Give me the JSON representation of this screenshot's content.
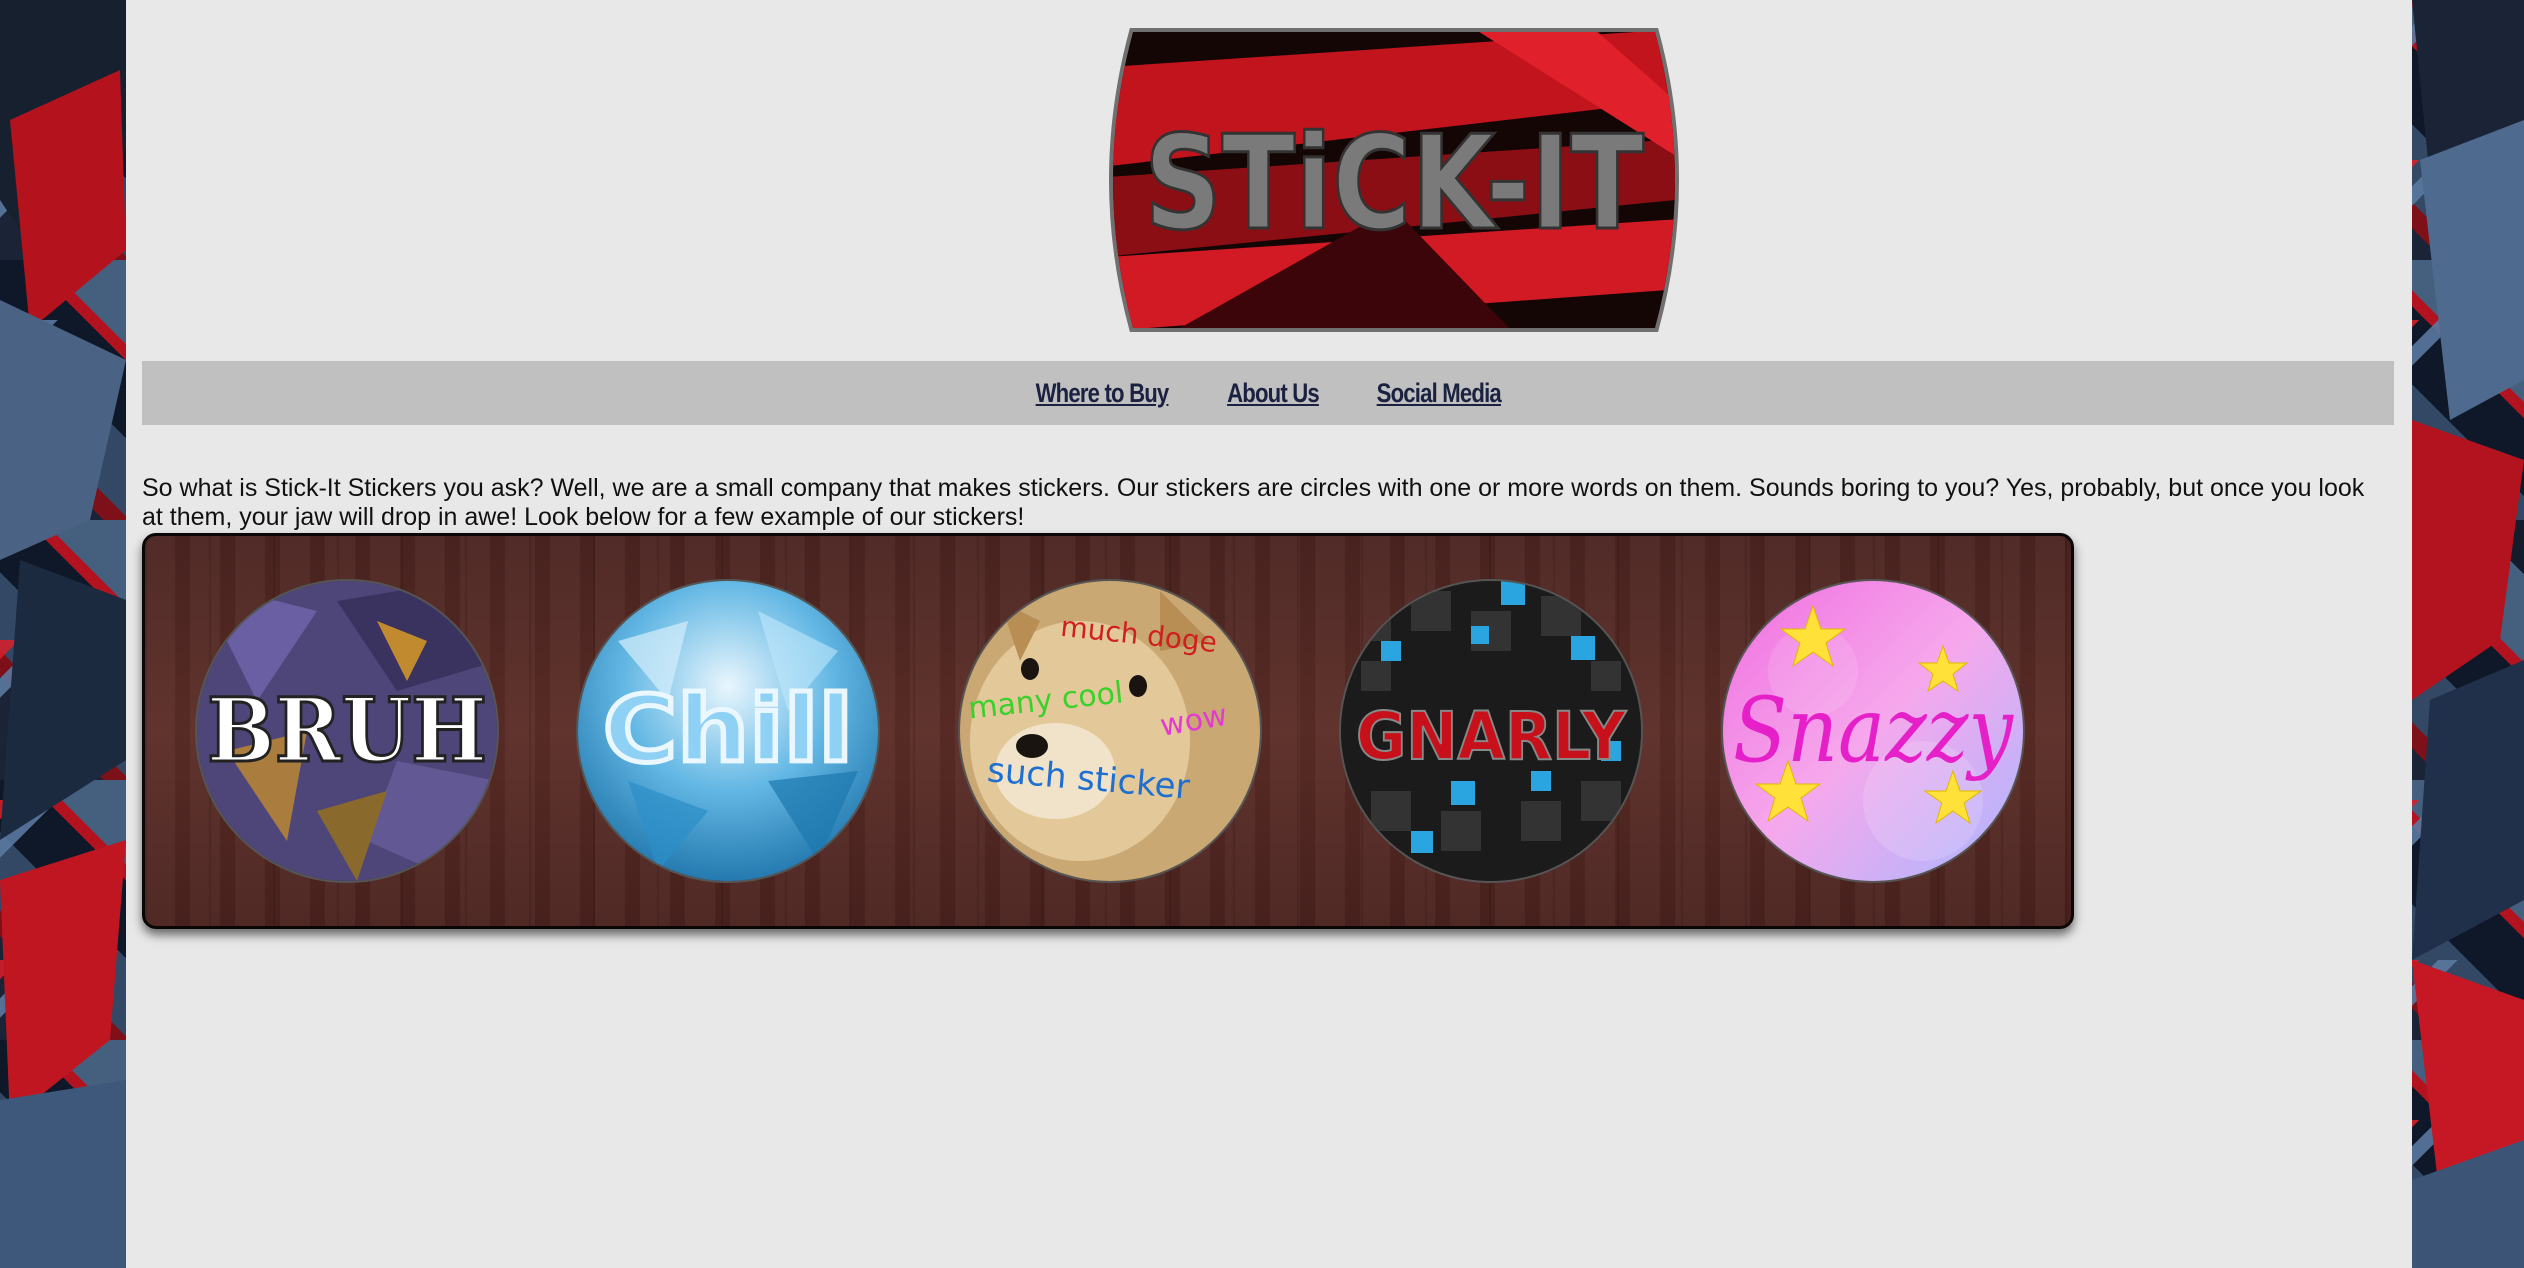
{
  "brand": {
    "logo_text": "STiCK-IT"
  },
  "nav": {
    "items": [
      {
        "label": "Where to Buy"
      },
      {
        "label": "About Us"
      },
      {
        "label": "Social Media"
      }
    ]
  },
  "intro": {
    "text": "So what is Stick-It Stickers you ask? Well, we are a small company that makes stickers. Our stickers are circles with one or more words on them. Sounds boring to you? Yes, probably, but once you look at them, your jaw will drop in awe! Look below for a few example of our stickers!"
  },
  "stickers": [
    {
      "text": "BRUH",
      "colors": {
        "bg": "#4e4678",
        "accent": "#c28a2e",
        "text": "#ffffff"
      }
    },
    {
      "text": "Chill",
      "colors": {
        "bg": "#2b8fc7",
        "accent": "#bfe7fb",
        "text": "#8fd1f4"
      }
    },
    {
      "words": [
        "much doge",
        "many cool",
        "wow",
        "such sticker"
      ],
      "colors": {
        "bg": "#c9a874",
        "much": "#d01f1f",
        "many": "#3ad12c",
        "wow": "#e33ad2",
        "such": "#1d6fd1"
      }
    },
    {
      "text": "GNARLY",
      "colors": {
        "bg": "#1b1b1b",
        "accent": "#2aa5e0",
        "text": "#c8101a"
      }
    },
    {
      "text": "Snazzy",
      "colors": {
        "bg": "#f08ae0",
        "accent": "#ffe13a",
        "text": "#e520c8"
      }
    }
  ],
  "colors": {
    "page_bg": "#e8e8e8",
    "nav_bg": "#c0c0c0",
    "nav_link": "#1b2140",
    "logo_red": "#c1141d",
    "logo_text": "#7a7a7a"
  }
}
